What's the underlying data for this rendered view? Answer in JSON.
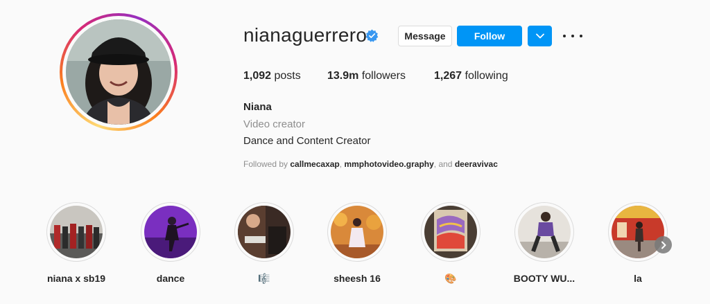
{
  "profile": {
    "username": "nianaguerrero",
    "verified": true,
    "buttons": {
      "message": "Message",
      "follow": "Follow"
    },
    "stats": {
      "posts_count": "1,092",
      "posts_label": "posts",
      "followers_count": "13.9m",
      "followers_label": "followers",
      "following_count": "1,267",
      "following_label": "following"
    },
    "bio": {
      "name": "Niana",
      "category": "Video creator",
      "text": "Dance and Content Creator",
      "followed_by_prefix": "Followed by",
      "followed_by_1": "callmecaxap",
      "followed_by_2": "mmphotovideo.graphy",
      "followed_by_and": ", and",
      "followed_by_3": "deeravivac"
    }
  },
  "highlights": [
    {
      "label": "niana x sb19"
    },
    {
      "label": "dance"
    },
    {
      "label": "🎼"
    },
    {
      "label": "sheesh 16"
    },
    {
      "label": "🎨"
    },
    {
      "label": "BOOTY WU..."
    },
    {
      "label": "la"
    }
  ],
  "colors": {
    "accent": "#0095f6",
    "text": "#262626",
    "muted": "#8e8e8e",
    "background": "#fafafa"
  },
  "icons": [
    "verified-badge-icon",
    "chevron-down-icon",
    "more-options-icon",
    "chevron-right-icon"
  ]
}
